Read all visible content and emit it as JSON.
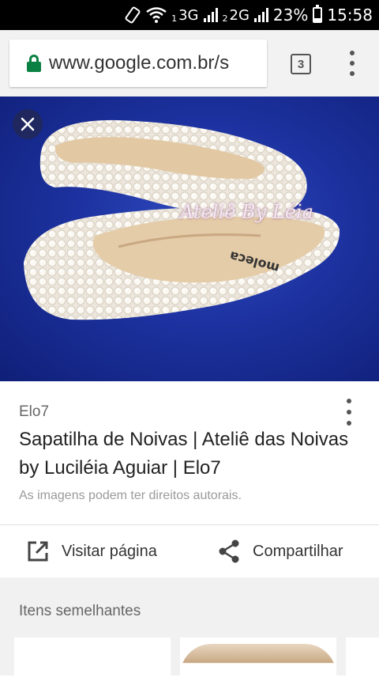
{
  "status_bar": {
    "sim1": "1",
    "net1": "3G",
    "sim2": "2",
    "net2": "2G",
    "battery_percent": "23%",
    "battery_level": 0.23,
    "time": "15:58",
    "icons": [
      "screen-rotation-icon",
      "wifi-icon",
      "signal-icon",
      "battery-icon"
    ]
  },
  "toolbar": {
    "url": "www.google.com.br/s",
    "tab_count": "3",
    "secure_color": "#0b8043"
  },
  "image": {
    "watermark": "Ateliê By Léia",
    "insole_brand": "moleca"
  },
  "result": {
    "source": "Elo7",
    "title": "Sapatilha de Noivas | Ateliê das Noivas by Luciléia Aguiar | Elo7",
    "copyright": "As imagens podem ter direitos autorais."
  },
  "actions": {
    "visit_label": "Visitar página",
    "share_label": "Compartilhar"
  },
  "similar": {
    "title": "Itens semelhantes"
  }
}
